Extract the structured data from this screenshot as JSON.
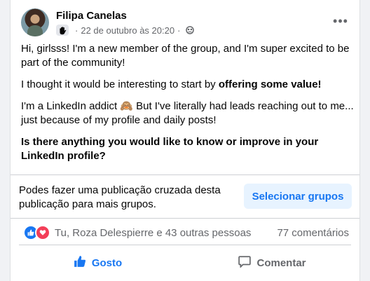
{
  "post": {
    "author": "Filipa Canelas",
    "date": "22 de outubro às 20:20",
    "separator": "·",
    "more_label": "•••",
    "paragraphs": {
      "p1": "Hi, girlsss! I'm a new member of the group, and I'm super excited to be part of the community!",
      "p2_plain": "I thought it would be interesting to start by ",
      "p2_bold": "offering some value!",
      "p3": "I'm a LinkedIn addict 🙈 But I've literally had leads reaching out to me... just because of my profile and daily posts!",
      "p4_bold": "Is there anything you would like to know or improve in your LinkedIn profile?"
    }
  },
  "crosspost": {
    "text": "Podes fazer uma publicação cruzada desta publicação para mais grupos.",
    "button_label": "Selecionar grupos"
  },
  "reactions": {
    "names": "Tu, Roza Delespierre e 43 outras pessoas",
    "comments": "77 comentários",
    "icons": [
      "like-icon",
      "love-icon"
    ]
  },
  "actions": {
    "like_label": "Gosto",
    "comment_label": "Comentar"
  },
  "colors": {
    "accent": "#1877f2",
    "love": "#f33e58",
    "secondary_text": "#65676b",
    "button_bg": "#e7f3ff"
  }
}
